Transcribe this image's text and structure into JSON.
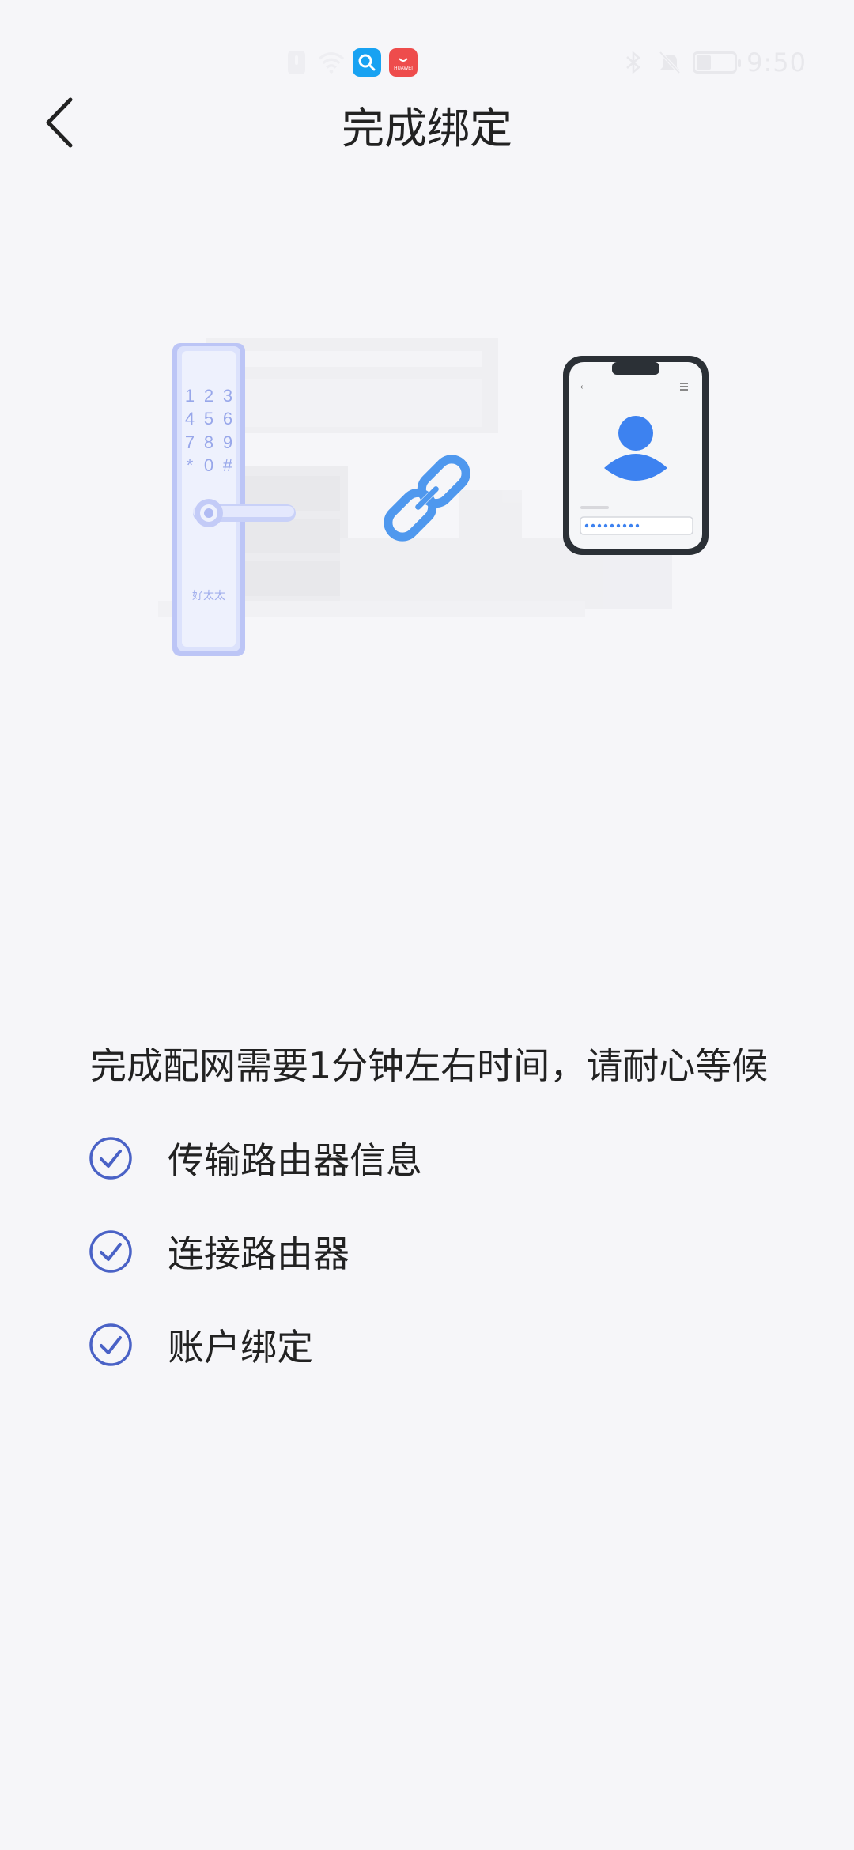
{
  "status_bar": {
    "time": "9:50",
    "app_badge_label": "HUAWEI",
    "icons": [
      "notification-icon",
      "wifi-icon",
      "search-app-icon",
      "huawei-store-icon",
      "bluetooth-icon",
      "mute-icon",
      "battery-icon"
    ]
  },
  "header": {
    "title": "完成绑定",
    "back_icon": "chevron-left-icon"
  },
  "illustration": {
    "lock_keypad": [
      "1",
      "2",
      "3",
      "4",
      "5",
      "6",
      "7",
      "8",
      "9",
      "*",
      "0",
      "#"
    ],
    "lock_brand": "好太太"
  },
  "main": {
    "wait_text": "完成配网需要1分钟左右时间，请耐心等候",
    "steps": [
      {
        "label": "传输路由器信息",
        "status": "done"
      },
      {
        "label": "连接路由器",
        "status": "done"
      },
      {
        "label": "账户绑定",
        "status": "done"
      }
    ]
  },
  "colors": {
    "accent": "#4a62c6",
    "link_blue": "#4f98ee",
    "avatar_blue": "#3d82f0",
    "background": "#f6f6f9"
  }
}
